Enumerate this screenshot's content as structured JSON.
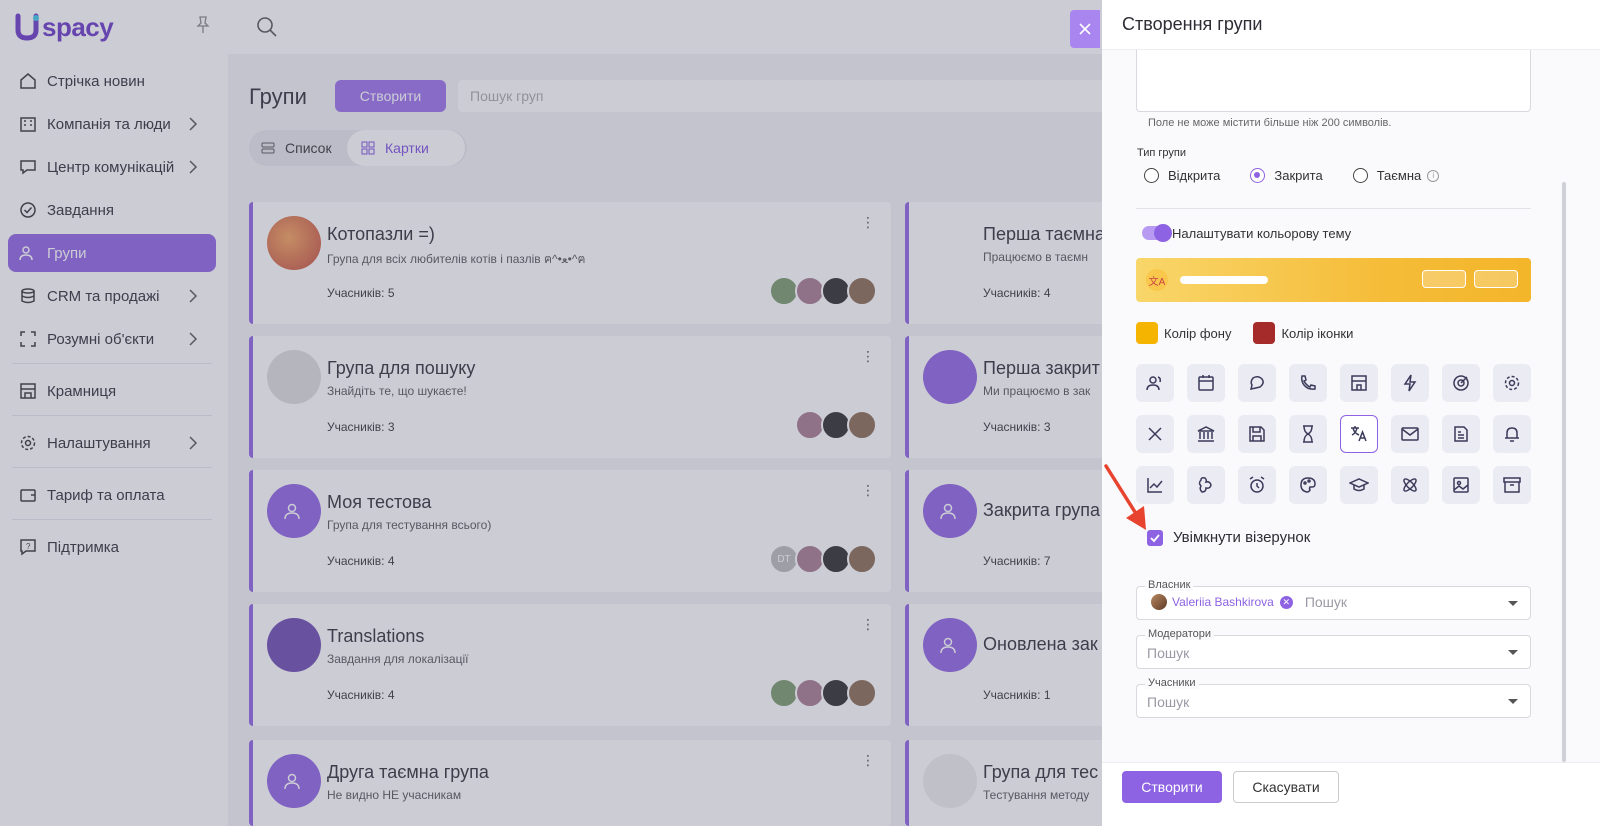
{
  "sidebar": {
    "logo_text": "spacy",
    "items": [
      {
        "label": "Стрічка новин",
        "icon": "home-icon"
      },
      {
        "label": "Компанія та люди",
        "icon": "building-icon"
      },
      {
        "label": "Центр комунікацій",
        "icon": "chat-icon"
      },
      {
        "label": "Завдання",
        "icon": "check-circle-icon"
      },
      {
        "label": "Групи",
        "icon": "users-icon"
      },
      {
        "label": "CRM та продажі",
        "icon": "database-icon"
      },
      {
        "label": "Розумні об'єкти",
        "icon": "smart-object-icon"
      },
      {
        "label": "Крамниця",
        "icon": "store-icon"
      },
      {
        "label": "Налаштування",
        "icon": "gear-icon"
      },
      {
        "label": "Тариф та оплата",
        "icon": "wallet-icon"
      },
      {
        "label": "Підтримка",
        "icon": "help-icon"
      }
    ]
  },
  "main": {
    "title": "Групи",
    "create_label": "Створити",
    "search_placeholder": "Пошук груп",
    "view_list": "Список",
    "view_cards": "Картки",
    "cards_left": [
      {
        "title": "Котопазли =)",
        "desc": "Група для всіх любителів котів і пазлів ฅ^•ﻌ•^ฅ",
        "members": "Учасників: 5"
      },
      {
        "title": "Група для пошуку",
        "desc": "Знайдіть те, що шукаєте!",
        "members": "Учасників: 3"
      },
      {
        "title": "Моя тестова",
        "desc": "Група для тестування всього)",
        "members": "Учасників: 4",
        "initials": "DT"
      },
      {
        "title": "Translations",
        "desc": "Завдання для локалізації",
        "members": "Учасників: 4"
      },
      {
        "title": "Друга таємна група",
        "desc": "Не видно НЕ учасникам",
        "members": ""
      }
    ],
    "cards_right": [
      {
        "title": "Перша таємна",
        "desc": "Працюємо в таємн",
        "members": "Учасників: 4"
      },
      {
        "title": "Перша закрит",
        "desc": "Ми працюємо в зак",
        "members": "Учасників: 3"
      },
      {
        "title": "Закрита група",
        "desc": "",
        "members": "Учасників: 7"
      },
      {
        "title": "Оновлена зак",
        "desc": "",
        "members": "Учасників: 1"
      },
      {
        "title": "Група для тес",
        "desc": "Тестування методу",
        "members": ""
      }
    ]
  },
  "drawer": {
    "title": "Створення групи",
    "hint": "Поле не може містити більше ніж 200 символів.",
    "type_label": "Тип групи",
    "types": [
      "Відкрита",
      "Закрита",
      "Таємна"
    ],
    "selected_type": "Закрита",
    "theme_toggle_label": "Налаштувати кольорову тему",
    "bg_color_label": "Колір фону",
    "icon_color_label": "Колір іконки",
    "bg_color": "#f5b400",
    "icon_color": "#a52a2a",
    "pattern_label": "Увімкнути візерунок",
    "owner_label": "Власник",
    "owner_name": "Valeriia Bashkirova",
    "owner_search": "Пошук",
    "moderators_label": "Модератори",
    "moderators_placeholder": "Пошук",
    "members_label": "Учасники",
    "members_placeholder": "Пошук",
    "submit_label": "Створити",
    "cancel_label": "Скасувати",
    "icons": [
      "users-icon",
      "calendar-icon",
      "chat-icon",
      "phone-icon",
      "store-icon",
      "lightning-icon",
      "target-icon",
      "gear-icon",
      "tools-icon",
      "bank-icon",
      "save-icon",
      "hourglass-icon",
      "translate-icon",
      "mail-icon",
      "document-icon",
      "bell-icon",
      "chart-icon",
      "puzzle-icon",
      "alarm-icon",
      "palette-icon",
      "graduation-icon",
      "atom-icon",
      "image-icon",
      "archive-icon"
    ],
    "selected_icon": "translate-icon"
  },
  "colors": {
    "accent": "#8e63e3"
  }
}
